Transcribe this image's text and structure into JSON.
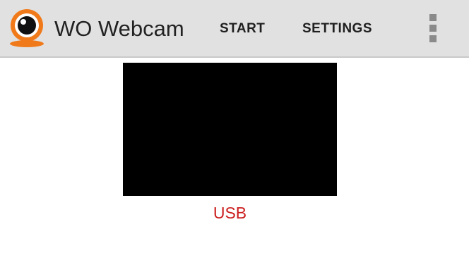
{
  "app": {
    "title": "WO Webcam",
    "logo_icon": "webcam-logo-icon",
    "accent_color": "#f07a1a"
  },
  "actions": {
    "start_label": "START",
    "settings_label": "SETTINGS",
    "overflow_icon": "overflow-menu-icon"
  },
  "preview": {
    "background_color": "#000000",
    "source_label": "USB",
    "source_label_color": "#cc1f1f"
  }
}
